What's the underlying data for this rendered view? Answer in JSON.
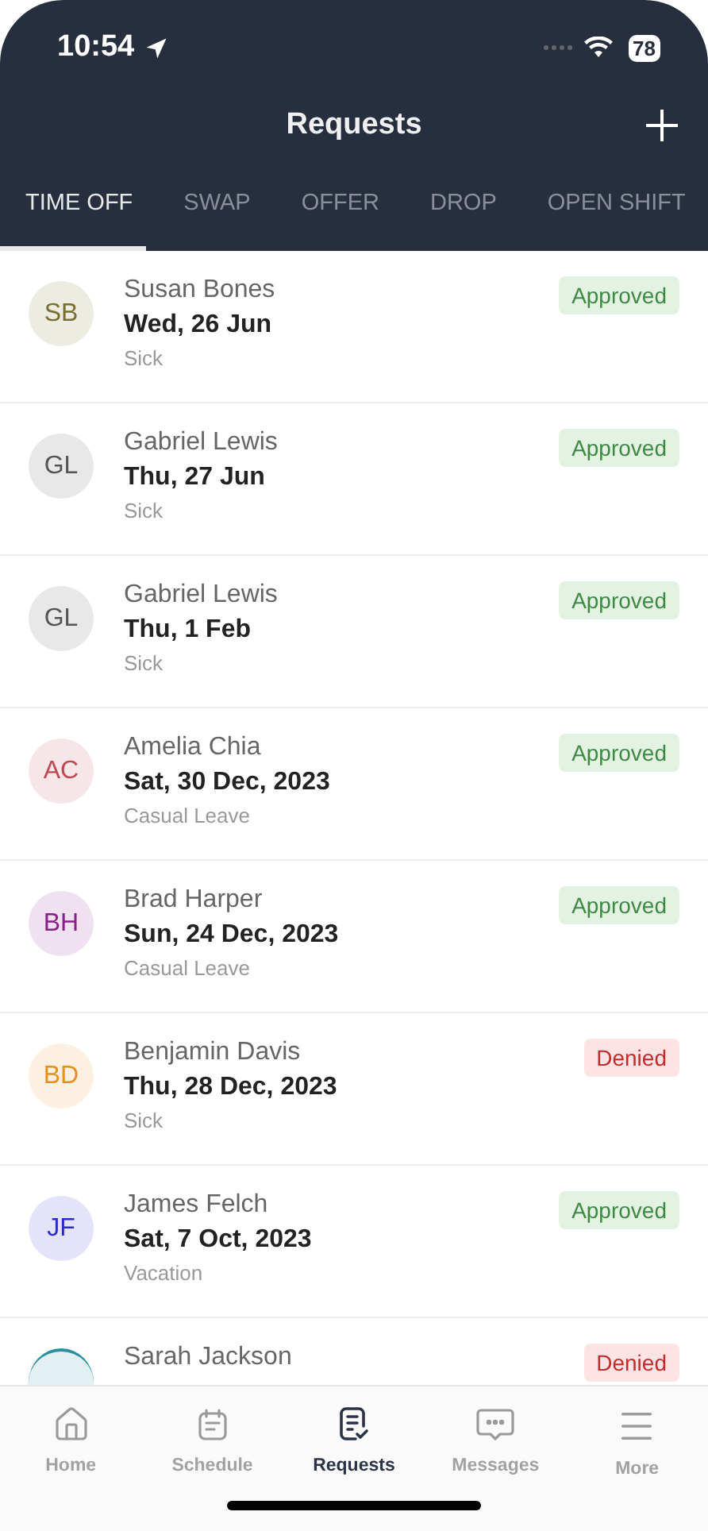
{
  "status_bar": {
    "time": "10:54",
    "battery": "78"
  },
  "header": {
    "title": "Requests"
  },
  "tabs": [
    {
      "label": "TIME OFF",
      "selected": true
    },
    {
      "label": "SWAP",
      "selected": false
    },
    {
      "label": "OFFER",
      "selected": false
    },
    {
      "label": "DROP",
      "selected": false
    },
    {
      "label": "OPEN SHIFT",
      "selected": false
    }
  ],
  "requests": [
    {
      "initials": "SB",
      "color": "#77702e",
      "name": "Susan Bones",
      "date": "Wed, 26 Jun",
      "type": "Sick",
      "status": {
        "label": "Approved",
        "kind": "approved"
      }
    },
    {
      "initials": "GL",
      "color": "#555555",
      "name": "Gabriel Lewis",
      "date": "Thu, 27 Jun",
      "type": "Sick",
      "status": {
        "label": "Approved",
        "kind": "approved"
      }
    },
    {
      "initials": "GL",
      "color": "#555555",
      "name": "Gabriel Lewis",
      "date": "Thu, 1 Feb",
      "type": "Sick",
      "status": {
        "label": "Approved",
        "kind": "approved"
      }
    },
    {
      "initials": "AC",
      "color": "#c0474f",
      "name": "Amelia Chia",
      "date": "Sat, 30 Dec, 2023",
      "type": "Casual Leave",
      "status": {
        "label": "Approved",
        "kind": "approved"
      }
    },
    {
      "initials": "BH",
      "color": "#8a1f8a",
      "name": "Brad Harper",
      "date": "Sun, 24 Dec, 2023",
      "type": "Casual Leave",
      "status": {
        "label": "Approved",
        "kind": "approved"
      }
    },
    {
      "initials": "BD",
      "color": "#e8901f",
      "name": "Benjamin Davis",
      "date": "Thu, 28 Dec, 2023",
      "type": "Sick",
      "status": {
        "label": "Denied",
        "kind": "denied"
      }
    },
    {
      "initials": "JF",
      "color": "#2a2ad0",
      "name": "James Felch",
      "date": "Sat, 7 Oct, 2023",
      "type": "Vacation",
      "status": {
        "label": "Approved",
        "kind": "approved"
      }
    },
    {
      "color": "#2a8fa0",
      "name": "Sarah Jackson",
      "status": {
        "label": "Denied",
        "kind": "denied"
      }
    }
  ],
  "nav": [
    {
      "label": "Home",
      "kind": "home",
      "selected": false
    },
    {
      "label": "Schedule",
      "kind": "schedule",
      "selected": false
    },
    {
      "label": "Requests",
      "kind": "requests",
      "selected": true
    },
    {
      "label": "Messages",
      "kind": "messages",
      "selected": false
    },
    {
      "label": "More",
      "kind": "more",
      "selected": false
    }
  ]
}
